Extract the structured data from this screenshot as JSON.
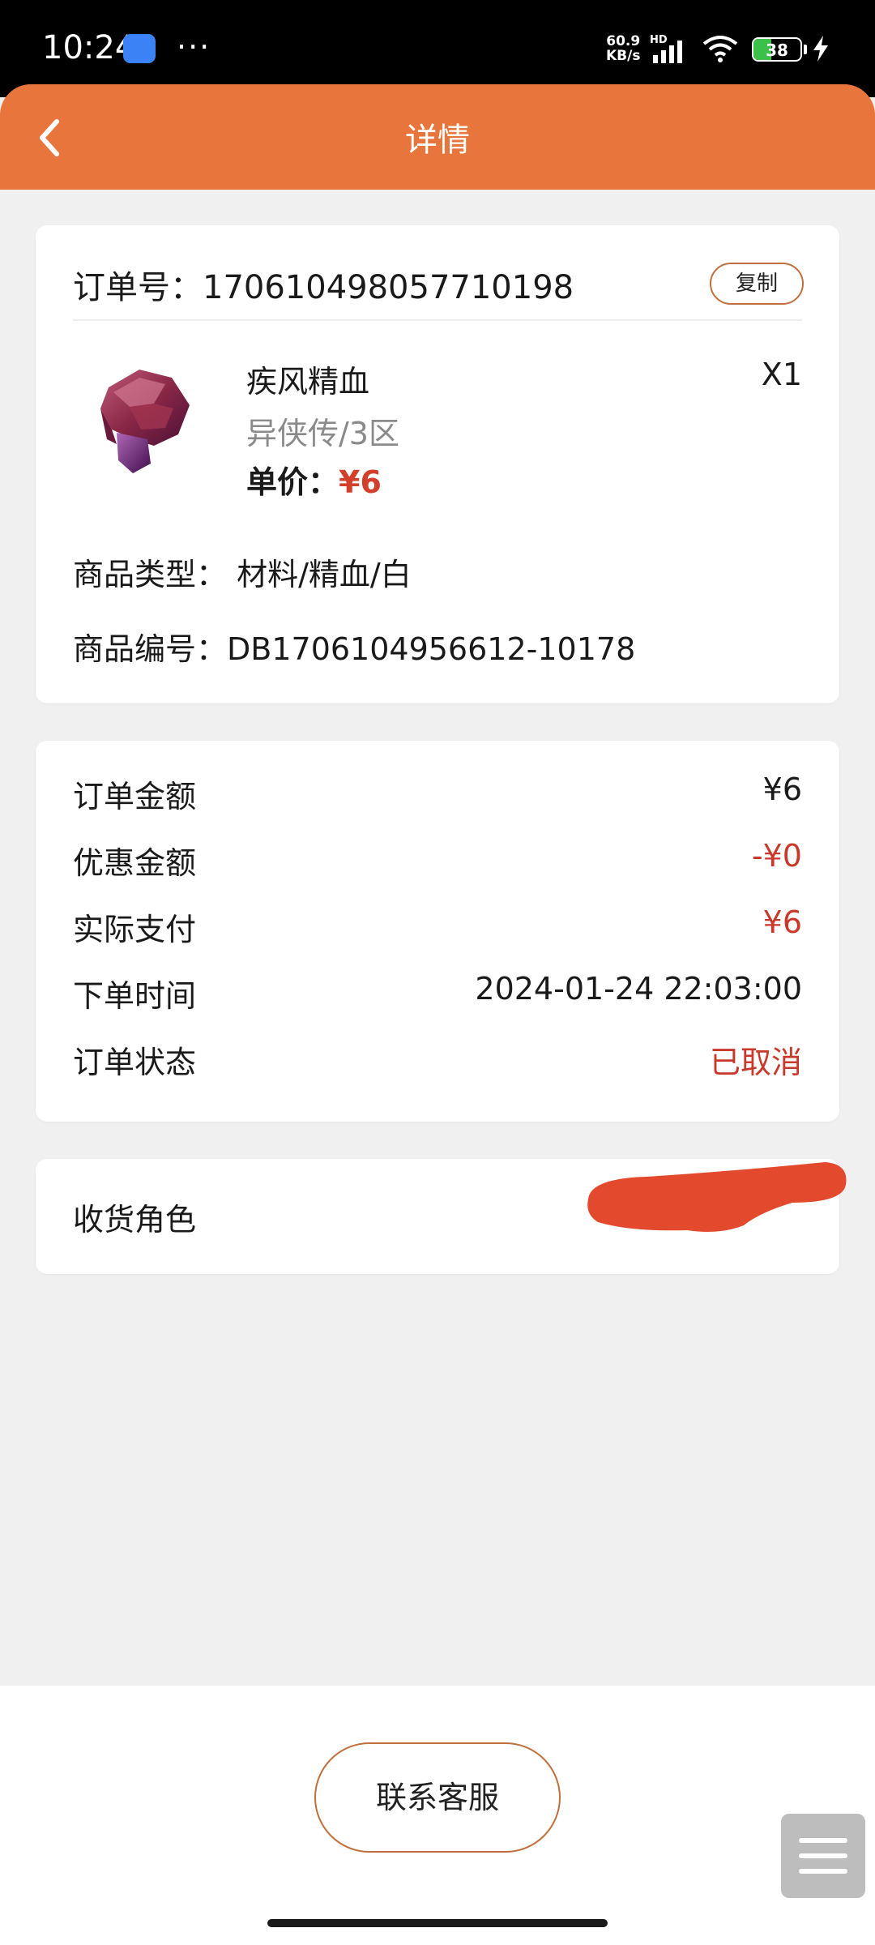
{
  "status_bar": {
    "time": "10:24",
    "dots": "···",
    "net_speed": "60.9",
    "net_unit": "KB/s",
    "hd": "HD",
    "battery": "38",
    "battery_level": 0.38,
    "icons": [
      "app-icon",
      "signal-icon",
      "wifi-icon",
      "battery-icon",
      "charging-icon"
    ]
  },
  "header": {
    "title": "详情",
    "back_icon": "chevron-left-icon"
  },
  "order": {
    "number_label": "订单号：",
    "number": "1706104980577101​98",
    "copy_label": "复制"
  },
  "product": {
    "image_icon": "red-ore-item-icon",
    "name": "疾风精血",
    "quantity": "X1",
    "server": "异侠传/3区",
    "price_label": "单价：",
    "price": "¥6",
    "type_label": "商品类型：",
    "type_value": "材料/精血/白",
    "code_label": "商品编号：",
    "code_value": "DB1706104956612-10178"
  },
  "summary": {
    "rows": [
      {
        "label": "订单金额",
        "value": "¥6"
      },
      {
        "label": "优惠金额",
        "value": "-¥0"
      },
      {
        "label": "实际支付",
        "value": "¥6"
      },
      {
        "label": "下单时间",
        "value": "2024-01-24 22:03:00"
      },
      {
        "label": "订单状态",
        "value": "已取消"
      }
    ]
  },
  "receiver": {
    "label": "收货角色"
  },
  "footer": {
    "service_button": "联系客服",
    "menu_icon": "hamburger-icon"
  },
  "colors": {
    "header": "#e8763c",
    "price": "#d23f2a",
    "status": "#c9392b",
    "redaction": "#e34a2d"
  }
}
